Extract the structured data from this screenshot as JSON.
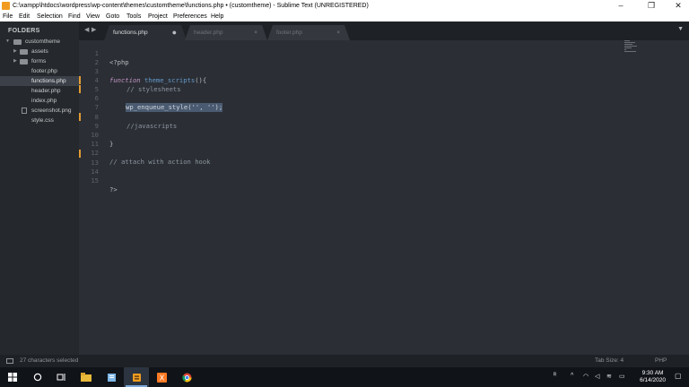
{
  "window": {
    "title": "C:\\xampp\\htdocs\\wordpress\\wp-content\\themes\\customtheme\\functions.php • (customtheme) - Sublime Text (UNREGISTERED)",
    "controls": {
      "minimize": "–",
      "maximize": "❐",
      "close": "✕"
    }
  },
  "menu": [
    "File",
    "Edit",
    "Selection",
    "Find",
    "View",
    "Goto",
    "Tools",
    "Project",
    "Preferences",
    "Help"
  ],
  "sidebar": {
    "heading": "FOLDERS",
    "root": "customtheme",
    "items": [
      {
        "label": "assets",
        "type": "folder"
      },
      {
        "label": "forms",
        "type": "folder"
      },
      {
        "label": "footer.php",
        "type": "file"
      },
      {
        "label": "functions.php",
        "type": "file"
      },
      {
        "label": "header.php",
        "type": "file"
      },
      {
        "label": "index.php",
        "type": "file"
      },
      {
        "label": "screenshot.png",
        "type": "image"
      },
      {
        "label": "style.css",
        "type": "file"
      }
    ],
    "active_index": 3
  },
  "tabs": [
    {
      "label": "functions.php",
      "active": true,
      "close": "●"
    },
    {
      "label": "header.php",
      "active": false,
      "close": "×"
    },
    {
      "label": "footer.php",
      "active": false,
      "close": "×"
    }
  ],
  "tab_nav": {
    "back": "◀",
    "forward": "▶",
    "menu": "▼"
  },
  "editor": {
    "line_numbers": [
      "1",
      "2",
      "3",
      "4",
      "5",
      "6",
      "7",
      "8",
      "9",
      "10",
      "11",
      "12",
      "13",
      "14",
      "15"
    ],
    "lines": {
      "l1": "<?php",
      "l3_kw": "function",
      "l3_fn": "theme_scripts",
      "l3_rest": "(){",
      "l4": "// stylesheets",
      "l6_fn": "wp_enqueue_style",
      "l6_rest": "('', '');",
      "l8": "//javascripts",
      "l10": "}",
      "l12": "// attach with action hook",
      "l15": "?>"
    },
    "modified_lines": [
      "5",
      "6",
      "9",
      "13"
    ]
  },
  "status": {
    "selection": "27 characters selected",
    "tab_size": "Tab Size: 4",
    "syntax": "PHP"
  },
  "taskbar": {
    "time": "9:30 AM",
    "date": "6/14/2020",
    "apps": [
      "windows-start",
      "search",
      "task-view",
      "file-explorer",
      "notepad",
      "sublime-text",
      "xampp",
      "chrome"
    ]
  },
  "colors": {
    "editor_bg": "#2b2f35",
    "sidebar_bg": "#25282c",
    "keyword": "#c594c5",
    "function": "#6699cc",
    "comment": "#8c959f",
    "modified_marker": "#e39b33",
    "selection": "#4a5a70"
  }
}
